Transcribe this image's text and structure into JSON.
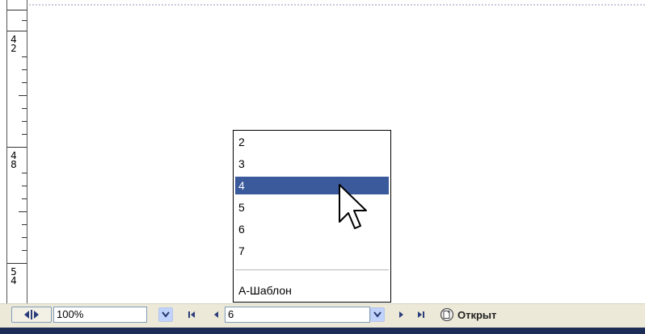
{
  "ruler": {
    "labels": [
      {
        "top": "4",
        "bottom": "2"
      },
      {
        "top": "4",
        "bottom": "8"
      },
      {
        "top": "5",
        "bottom": "4"
      }
    ]
  },
  "page_list": {
    "items": [
      "2",
      "3",
      "4",
      "5",
      "6",
      "7"
    ],
    "selected": "4",
    "master_label": "А-Шаблон"
  },
  "statusbar": {
    "zoom_value": "100%",
    "page_value": "6",
    "open_label": "Открыт"
  },
  "colors": {
    "selection": "#3a5a9c",
    "statusbar": "#ece9d8",
    "dropdown_button": "#c1d3fb",
    "bottom_strip": "#1e2c58"
  },
  "icons": {
    "split-toggle": "split-view-icon",
    "dropdown": "chevron-down-icon",
    "first": "first-page-icon",
    "prev": "previous-page-icon",
    "next": "next-page-icon",
    "last": "last-page-icon",
    "open": "open-document-icon",
    "cursor": "mouse-pointer-icon"
  }
}
